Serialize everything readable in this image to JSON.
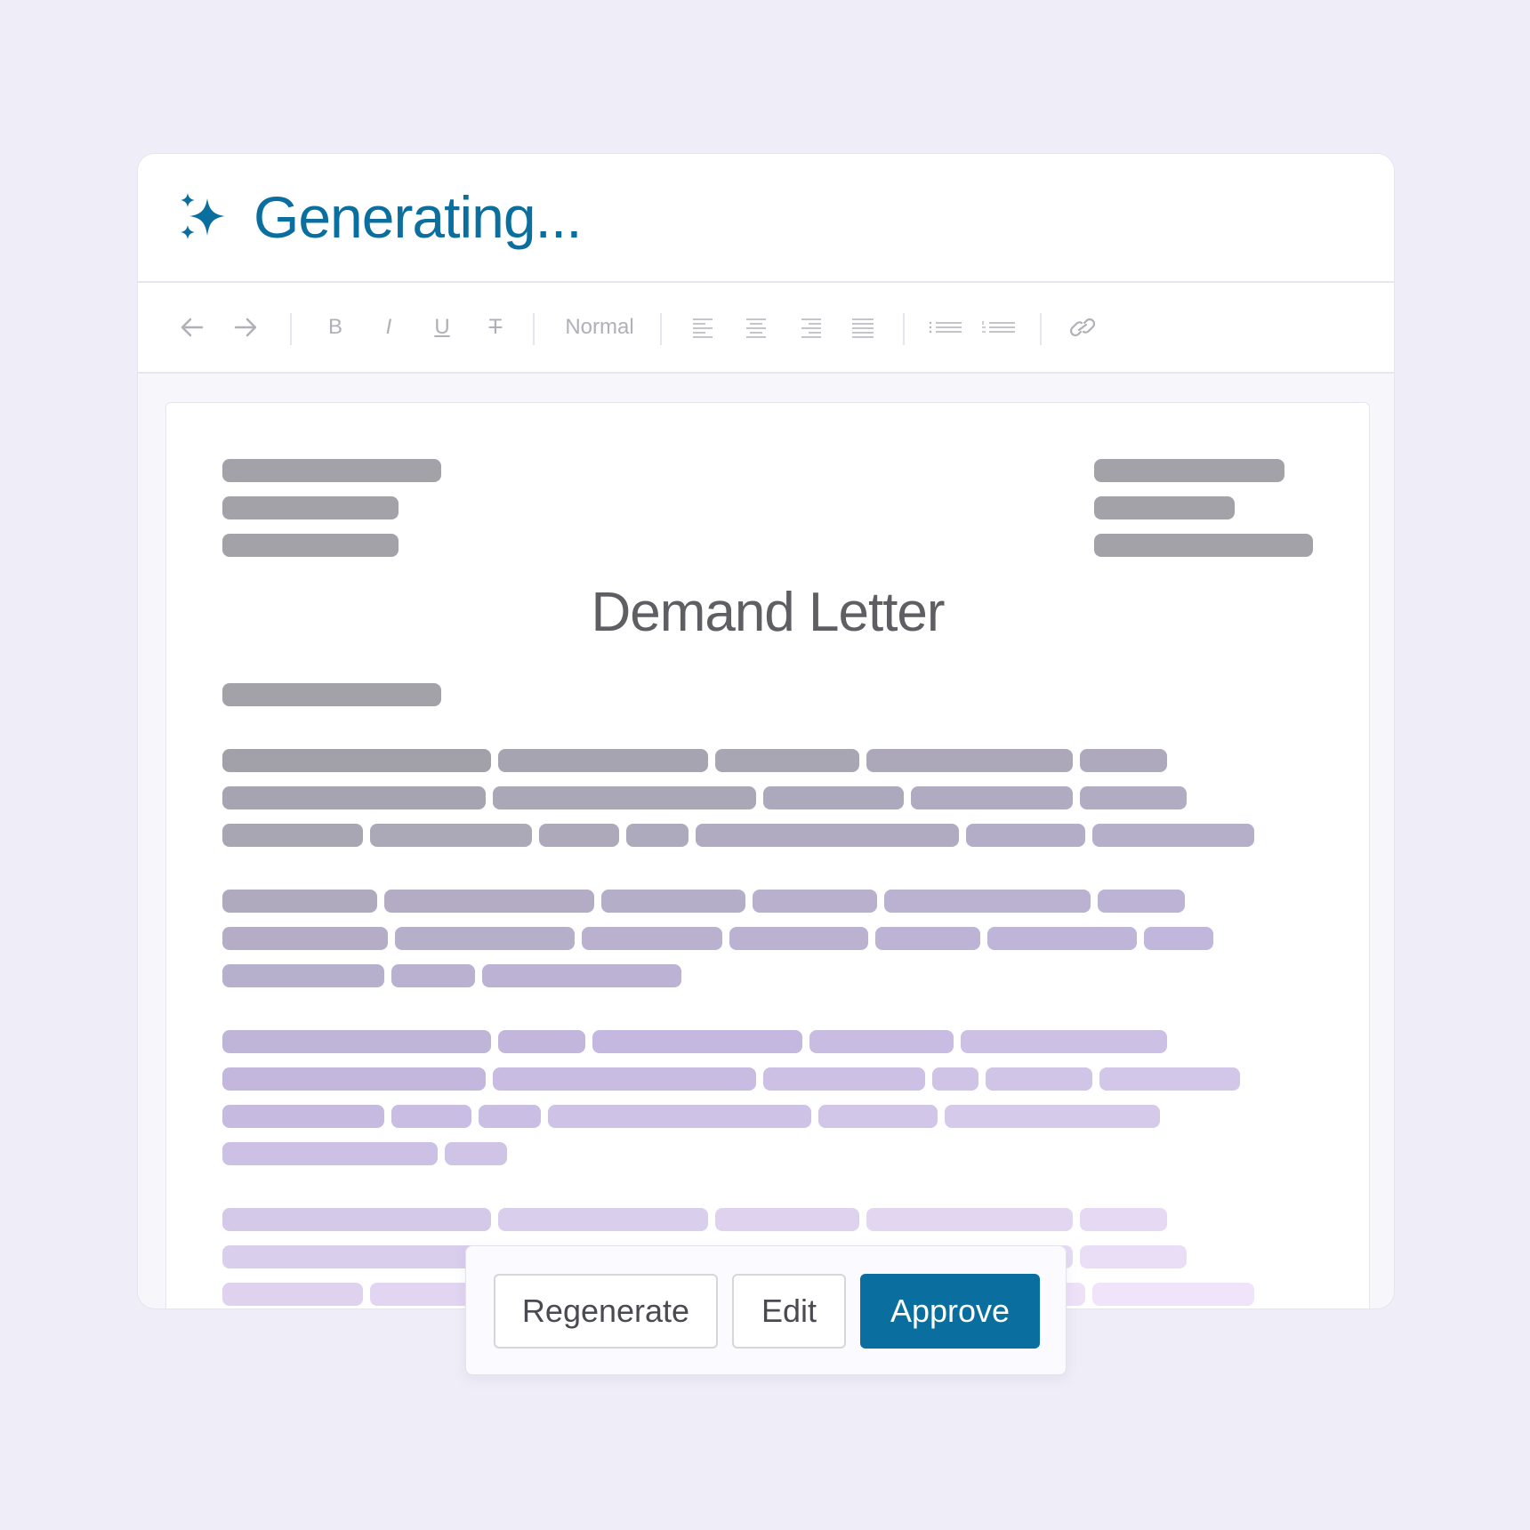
{
  "header": {
    "title": "Generating...",
    "sparkle_icon": "sparkle-icon",
    "accent_color": "#0a6e9e"
  },
  "toolbar": {
    "undo_icon": "undo-arrow-icon",
    "redo_icon": "redo-arrow-icon",
    "bold_label": "B",
    "italic_label": "I",
    "underline_label": "U",
    "strikethrough_label": "T",
    "text_style": "Normal",
    "align_icons": [
      "align-left-icon",
      "align-center-icon",
      "align-right-icon",
      "align-justify-icon"
    ],
    "list_icons": [
      "bulleted-list-icon",
      "numbered-list-icon"
    ],
    "link_icon": "link-icon"
  },
  "document": {
    "title": "Demand Letter"
  },
  "actions": {
    "regenerate_label": "Regenerate",
    "edit_label": "Edit",
    "approve_label": "Approve",
    "primary_color": "#0a6e9e"
  }
}
